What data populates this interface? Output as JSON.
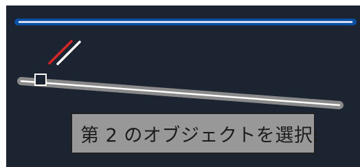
{
  "cad_viewport": {
    "background_color": "#1b2430",
    "top_line_color": "#0a4fa3",
    "selected_line_color": "#9a9a9a",
    "cursor_icon": "pickbox-cursor-icon",
    "line_icon": "line-segment-icon"
  },
  "command_prompt": {
    "text": "第 2 のオブジェクトを選択:"
  }
}
